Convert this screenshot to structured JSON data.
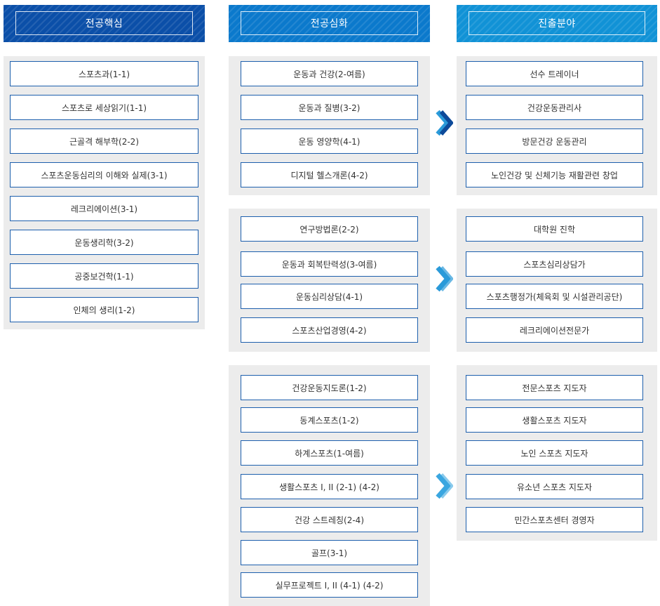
{
  "headers": {
    "core": "전공핵심",
    "advanced": "전공심화",
    "career": "진출분야"
  },
  "core_courses": [
    "스포츠과(1-1)",
    "스포츠로 세상읽기(1-1)",
    "근골격 해부학(2-2)",
    "스포츠운동심리의 이해와 실제(3-1)",
    "레크리에이션(3-1)",
    "운동생리학(3-2)",
    "공중보건학(1-1)",
    "인체의 생리(1-2)"
  ],
  "tracks": [
    {
      "courses": [
        "운동과 건강(2-여름)",
        "운동과 질병(3-2)",
        "운동 영양학(4-1)",
        "디지털 헬스개론(4-2)"
      ],
      "careers": [
        "선수 트레이너",
        "건강운동관리사",
        "방문건강 운동관리",
        "노인건강 및 신체기능 재활관련 창업"
      ]
    },
    {
      "courses": [
        "연구방법론(2-2)",
        "운동과 회복탄력성(3-여름)",
        "운동심리상담(4-1)",
        "스포츠산업경영(4-2)"
      ],
      "careers": [
        "대학원 진학",
        "스포츠심리상담가",
        "스포츠행정가(체육회 및 시설관리공단)",
        "레크리에이션전문가"
      ]
    },
    {
      "courses": [
        "건강운동지도론(1-2)",
        "동계스포츠(1-2)",
        "하계스포츠(1-여름)",
        "생활스포츠 I, II (2-1) (4-2)",
        "건강 스트레칭(2-4)",
        "골프(3-1)",
        "실무프로젝트 I, II (4-1) (4-2)"
      ],
      "careers": [
        "전문스포츠 지도자",
        "생활스포츠 지도자",
        "노인 스포츠 지도자",
        "유소년 스포츠 지도자",
        "민간스포츠센터 경영자"
      ]
    }
  ],
  "colors": {
    "header_core": "#0b4fa8",
    "header_advanced": "#0b79cc",
    "header_career": "#1192d6",
    "item_border": "#1d5fad",
    "panel_bg": "#ececec",
    "arrow_dark": "#0d4a9a",
    "arrow_light": "#2a9ad9"
  },
  "icons": [
    "chevron-right-icon"
  ]
}
